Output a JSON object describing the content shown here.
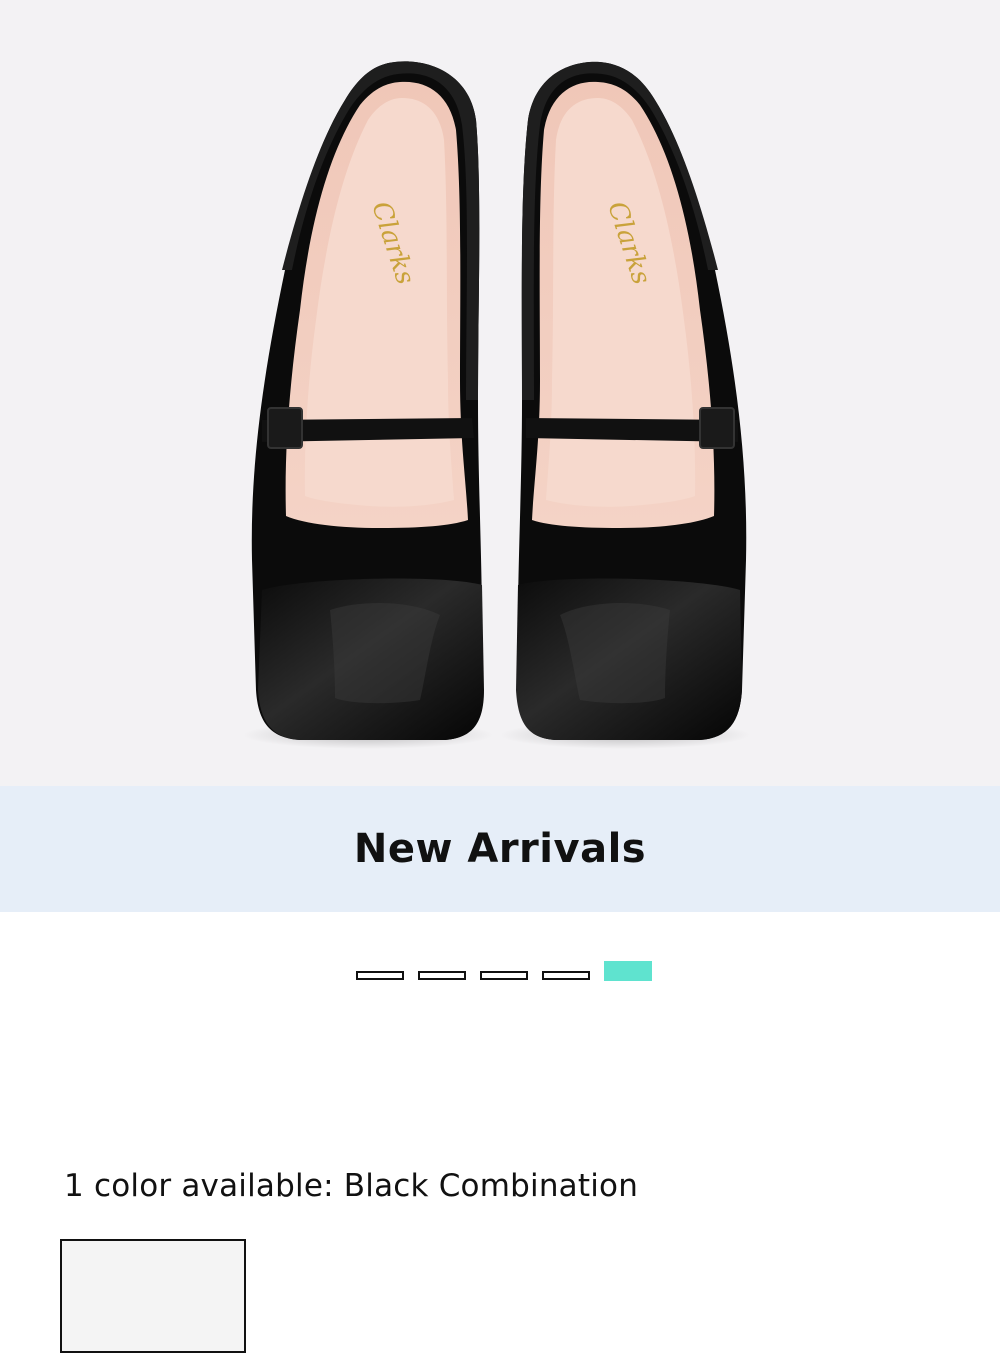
{
  "product": {
    "image_alt": "Black suede Mary Jane flats with patent toe caps",
    "brand_logo": "Clarks"
  },
  "banner": {
    "label": "New Arrivals",
    "background": "#e6eef8"
  },
  "carousel": {
    "total_slides": 5,
    "active_index": 4,
    "active_color": "#5fe3cf"
  },
  "colors": {
    "label": "1 color available: Black Combination"
  },
  "swatches": [
    {
      "name": "Black Combination",
      "selected": true
    }
  ]
}
